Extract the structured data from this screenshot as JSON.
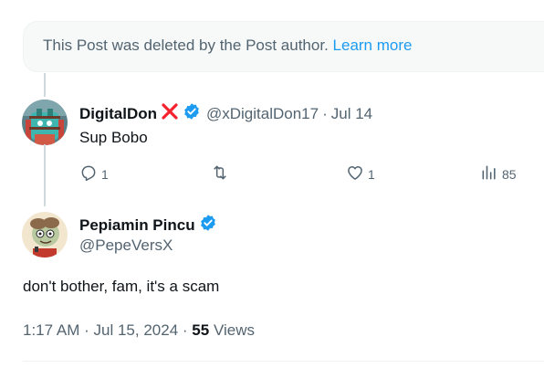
{
  "deleted_notice": {
    "text": "This Post was deleted by the Post author.",
    "link": "Learn more"
  },
  "reply_post": {
    "display_name": "DigitalDon",
    "handle": "@xDigitalDon17",
    "separator": "·",
    "date": "Jul 14",
    "text": "Sup Bobo",
    "replies": "1",
    "likes": "1",
    "views": "85"
  },
  "main_post": {
    "display_name": "Pepiamin Pincu",
    "handle": "@PepeVersX",
    "text": "don't bother, fam, it's a scam",
    "time": "1:17 AM",
    "sep1": "·",
    "date": "Jul 15, 2024",
    "sep2": "·",
    "views_count": "55",
    "views_label": "Views"
  },
  "colors": {
    "accent": "#1d9bf0",
    "muted": "#536471",
    "text": "#0f1419",
    "cross": "#f4212e"
  },
  "icons": {
    "verified": "verified-badge-icon",
    "cross": "red-x-icon",
    "reply": "reply-icon",
    "repost": "repost-icon",
    "like": "heart-icon",
    "views": "views-chart-icon"
  }
}
